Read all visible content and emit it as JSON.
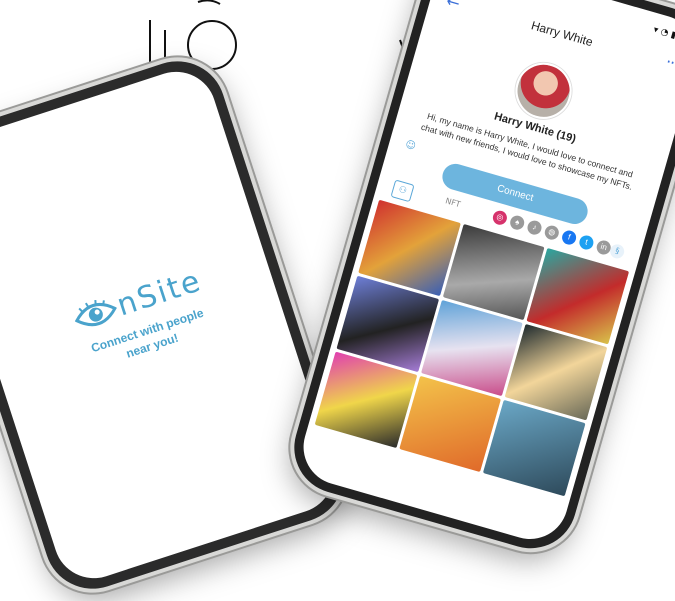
{
  "splash": {
    "logo_text": "nSite",
    "tagline_line1": "Connect with people",
    "tagline_line2": "near you!"
  },
  "profile": {
    "header_title": "Harry White",
    "name_age": "Harry White (19)",
    "bio": "Hi, my name is Harry White, I would love to connect and chat with new friends, I would love to showcase my NFTs.",
    "connect_label": "Connect",
    "nft_tab_label": "NFT"
  },
  "social_icons": [
    {
      "name": "instagram-icon",
      "glyph": "◎",
      "color": "#d6336c"
    },
    {
      "name": "snapchat-icon",
      "glyph": "♠",
      "color": "#9a9a9a"
    },
    {
      "name": "tiktok-icon",
      "glyph": "♪",
      "color": "#9a9a9a"
    },
    {
      "name": "globe-icon",
      "glyph": "◍",
      "color": "#9a9a9a"
    },
    {
      "name": "facebook-icon",
      "glyph": "f",
      "color": "#1877f2"
    },
    {
      "name": "twitter-icon",
      "glyph": "t",
      "color": "#1da1f2"
    },
    {
      "name": "linkedin-icon",
      "glyph": "in",
      "color": "#9a9a9a"
    }
  ],
  "colors": {
    "accent": "#4aa3cc",
    "button": "#6db5de",
    "back_arrow": "#3b6fd8"
  }
}
